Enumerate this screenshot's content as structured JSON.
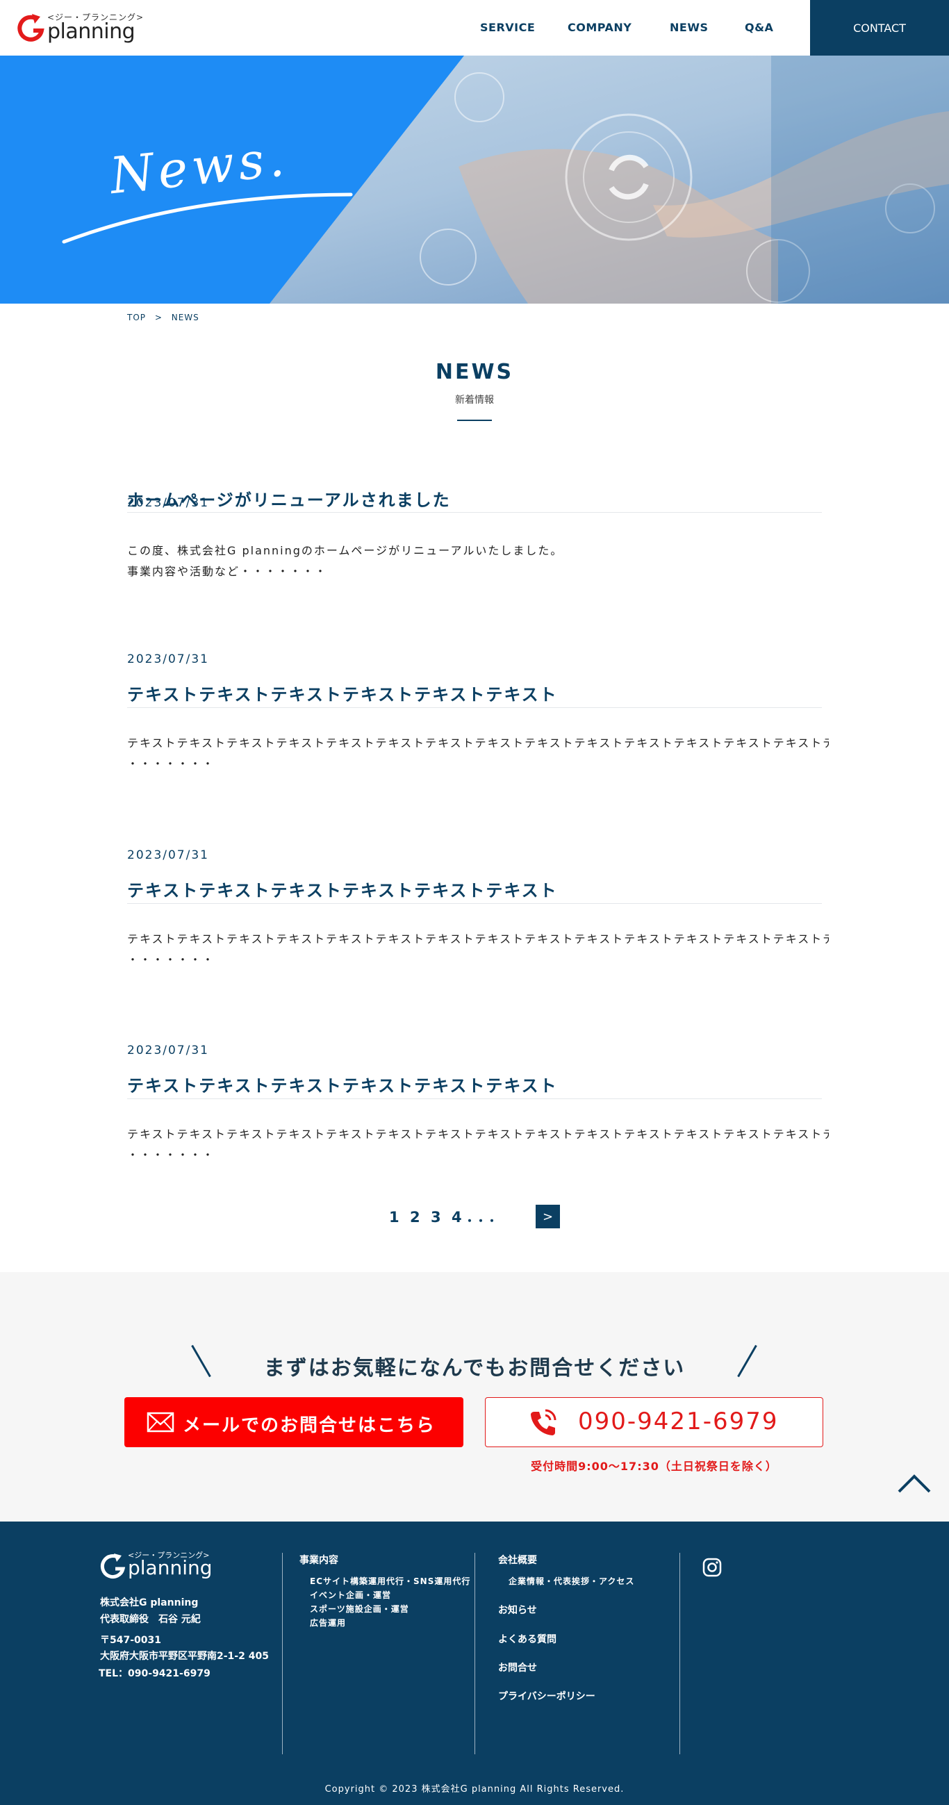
{
  "header": {
    "logo_kana": "<ジー・プランニング>",
    "logo_word": "planning",
    "nav": [
      "SERVICE",
      "COMPANY",
      "NEWS",
      "Q&A"
    ],
    "contact_label": "CONTACT"
  },
  "hero": {
    "script_text": "News."
  },
  "breadcrumb": {
    "top": "TOP",
    "sep": ">",
    "current": "NEWS"
  },
  "section": {
    "title_en": "NEWS",
    "title_jp": "新着情報"
  },
  "news": [
    {
      "date": "2023/07/31",
      "title": "ホームページがリニューアルされました",
      "body_line1": "この度、株式会社G planningのホームページがリニューアルいたしました。",
      "body_line2": "事業内容や活動など・・・・・・・"
    },
    {
      "date": "2023/07/31",
      "title": "テキストテキストテキストテキストテキストテキスト",
      "body_line1": "テキストテキストテキストテキストテキストテキストテキストテキストテキストテキストテキストテキストテキストテキストテ",
      "body_line2": "・・・・・・・"
    },
    {
      "date": "2023/07/31",
      "title": "テキストテキストテキストテキストテキストテキスト",
      "body_line1": "テキストテキストテキストテキストテキストテキストテキストテキストテキストテキストテキストテキストテキストテキストテ",
      "body_line2": "・・・・・・・"
    },
    {
      "date": "2023/07/31",
      "title": "テキストテキストテキストテキストテキストテキスト",
      "body_line1": "テキストテキストテキストテキストテキストテキストテキストテキストテキストテキストテキストテキストテキストテキストテ",
      "body_line2": "・・・・・・・"
    }
  ],
  "pagination": {
    "pages": [
      "1",
      "2",
      "3",
      "4"
    ],
    "ellipsis": "・・・",
    "next": ">"
  },
  "contact": {
    "heading": "まずはお気軽になんでもお問合せください",
    "mail_label": "メールでのお問合せはこちら",
    "tel_number": "090-9421-6979",
    "hours": "受付時間9:00〜17:30（土日祝祭日を除く）"
  },
  "footer": {
    "logo_kana": "<ジー・プランニング>",
    "logo_word": "planning",
    "company": "株式会社G planning",
    "rep": "代表取締役　石谷 元紀",
    "zip": "〒547-0031",
    "address": "大阪府大阪市平野区平野南2-1-2 405",
    "tel": "TEL：090-9421-6979",
    "business_head": "事業内容",
    "business_items": [
      "ECサイト構築運用代行・SNS運用代行",
      "イベント企画・運営",
      "スポーツ施設企画・運営",
      "広告運用"
    ],
    "company_head": "会社概要",
    "company_sub": "企業情報・代表挨拶・アクセス",
    "links": [
      "お知らせ",
      "よくある質問",
      "お問合せ",
      "プライバシーポリシー"
    ],
    "copyright": "Copyright © 2023 株式会社G planning All Rights Reserved."
  },
  "colors": {
    "navy": "#0b3f62",
    "hero_blue": "#1e8cf5",
    "red": "#fc0000",
    "contact_bg": "#f6f6f6"
  },
  "icons": [
    "logo-arrow-icon",
    "mail-icon",
    "phone-icon",
    "chevron-up-icon",
    "instagram-icon"
  ]
}
